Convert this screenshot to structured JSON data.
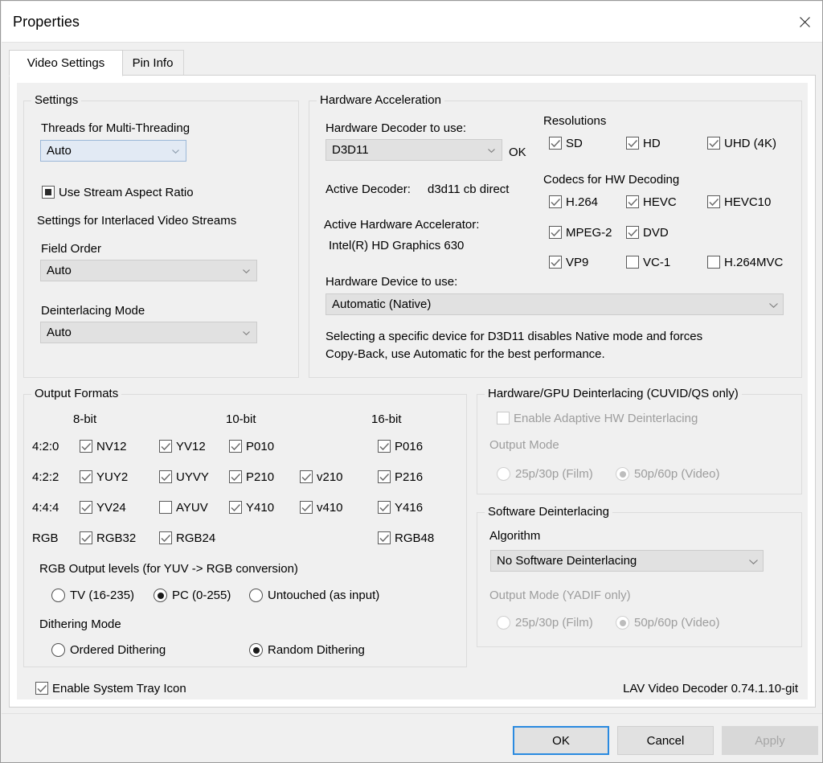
{
  "window": {
    "title": "Properties",
    "close_icon": "close-icon"
  },
  "tabs": [
    {
      "label": "Video Settings",
      "active": true
    },
    {
      "label": "Pin Info",
      "active": false
    }
  ],
  "settings_group": {
    "title": "Settings",
    "threads_label": "Threads for Multi-Threading",
    "threads_value": "Auto",
    "use_stream_aspect_ratio": "Use Stream Aspect Ratio",
    "interlaced_header": "Settings for Interlaced Video Streams",
    "field_order_label": "Field Order",
    "field_order_value": "Auto",
    "deinterlacing_mode_label": "Deinterlacing Mode",
    "deinterlacing_mode_value": "Auto"
  },
  "hardware_acceleration": {
    "title": "Hardware Acceleration",
    "decoder_label": "Hardware Decoder to use:",
    "decoder_value": "D3D11",
    "decoder_status": "OK",
    "active_decoder_label": "Active Decoder:",
    "active_decoder_value": "d3d11 cb direct",
    "active_accelerator_label": "Active Hardware Accelerator:",
    "active_accelerator_value": "Intel(R) HD Graphics 630",
    "device_label": "Hardware Device to use:",
    "device_value": "Automatic (Native)",
    "hint_line1": "Selecting a specific device for D3D11 disables Native mode and forces",
    "hint_line2": "Copy-Back, use Automatic for the best performance.",
    "resolutions_title": "Resolutions",
    "resolutions": [
      {
        "label": "SD",
        "checked": true
      },
      {
        "label": "HD",
        "checked": true
      },
      {
        "label": "UHD (4K)",
        "checked": true
      }
    ],
    "codecs_title": "Codecs for HW Decoding",
    "codecs": [
      {
        "label": "H.264",
        "checked": true
      },
      {
        "label": "HEVC",
        "checked": true
      },
      {
        "label": "HEVC10",
        "checked": true
      },
      {
        "label": "MPEG-2",
        "checked": true
      },
      {
        "label": "DVD",
        "checked": true
      },
      {
        "label": "VP9",
        "checked": true
      },
      {
        "label": "VC-1",
        "checked": false
      },
      {
        "label": "H.264MVC",
        "checked": false
      }
    ]
  },
  "output_formats": {
    "title": "Output Formats",
    "col_headers": [
      "8-bit",
      "10-bit",
      "16-bit"
    ],
    "row_labels": [
      "4:2:0",
      "4:2:2",
      "4:4:4",
      "RGB"
    ],
    "formats": [
      {
        "label": "NV12",
        "checked": true
      },
      {
        "label": "YV12",
        "checked": true
      },
      {
        "label": "P010",
        "checked": true
      },
      {
        "label": "P016",
        "checked": true
      },
      {
        "label": "YUY2",
        "checked": true
      },
      {
        "label": "UYVY",
        "checked": true
      },
      {
        "label": "P210",
        "checked": true
      },
      {
        "label": "v210",
        "checked": true
      },
      {
        "label": "P216",
        "checked": true
      },
      {
        "label": "YV24",
        "checked": true
      },
      {
        "label": "AYUV",
        "checked": false
      },
      {
        "label": "Y410",
        "checked": true
      },
      {
        "label": "v410",
        "checked": true
      },
      {
        "label": "Y416",
        "checked": true
      },
      {
        "label": "RGB32",
        "checked": true
      },
      {
        "label": "RGB24",
        "checked": true
      },
      {
        "label": "RGB48",
        "checked": true
      }
    ],
    "rgb_levels_label": "RGB Output levels (for YUV -> RGB conversion)",
    "rgb_levels": [
      {
        "label": "TV (16-235)",
        "selected": false
      },
      {
        "label": "PC (0-255)",
        "selected": true
      },
      {
        "label": "Untouched (as input)",
        "selected": false
      }
    ],
    "dithering_label": "Dithering Mode",
    "dithering": [
      {
        "label": "Ordered Dithering",
        "selected": false
      },
      {
        "label": "Random Dithering",
        "selected": true
      }
    ]
  },
  "hw_deinterlacing": {
    "title": "Hardware/GPU Deinterlacing (CUVID/QS only)",
    "enable_label": "Enable Adaptive HW Deinterlacing",
    "enable_checked": false,
    "output_mode_label": "Output Mode",
    "modes": [
      {
        "label": "25p/30p (Film)",
        "selected": false
      },
      {
        "label": "50p/60p (Video)",
        "selected": true
      }
    ]
  },
  "sw_deinterlacing": {
    "title": "Software Deinterlacing",
    "algorithm_label": "Algorithm",
    "algorithm_value": "No Software Deinterlacing",
    "output_mode_label": "Output Mode (YADIF only)",
    "modes": [
      {
        "label": "25p/30p (Film)",
        "selected": false
      },
      {
        "label": "50p/60p (Video)",
        "selected": true
      }
    ]
  },
  "footer": {
    "tray_icon_label": "Enable System Tray Icon",
    "tray_icon_checked": true,
    "version": "LAV Video Decoder 0.74.1.10-git"
  },
  "buttons": {
    "ok": "OK",
    "cancel": "Cancel",
    "apply": "Apply"
  }
}
